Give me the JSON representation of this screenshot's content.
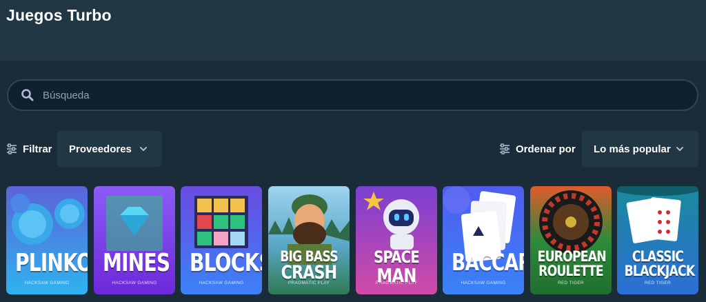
{
  "page": {
    "title": "Juegos Turbo"
  },
  "search": {
    "placeholder": "Búsqueda",
    "icon": "search-icon"
  },
  "filter": {
    "label": "Filtrar",
    "icon": "sliders-icon",
    "providers_label": "Proveedores"
  },
  "sort": {
    "label": "Ordenar por",
    "icon": "sliders-icon",
    "value": "Lo más popular"
  },
  "colors": {
    "background": "#1a2c38",
    "header_band": "#213743",
    "input_bg": "#0f212e",
    "input_border": "#2f4553"
  },
  "games": [
    {
      "title": "PLINKO",
      "provider": "HACKSAW GAMING"
    },
    {
      "title": "MINES",
      "provider": "HACKSAW GAMING"
    },
    {
      "title": "BLOCKS",
      "provider": "HACKSAW GAMING"
    },
    {
      "title_line1": "BIG BASS",
      "title_line2": "CRASH",
      "provider": "PRAGMATIC PLAY"
    },
    {
      "title_line1": "SPACE",
      "title_line2": "MAN",
      "provider": "PRAGMATIC PLAY"
    },
    {
      "title": "BACCARAT",
      "provider": "HACKSAW GAMING"
    },
    {
      "title_line1": "EUROPEAN",
      "title_line2": "ROULETTE",
      "provider": "RED TIGER"
    },
    {
      "title_line1": "CLASSIC",
      "title_line2": "BLACKJACK",
      "provider": "RED TIGER"
    }
  ]
}
